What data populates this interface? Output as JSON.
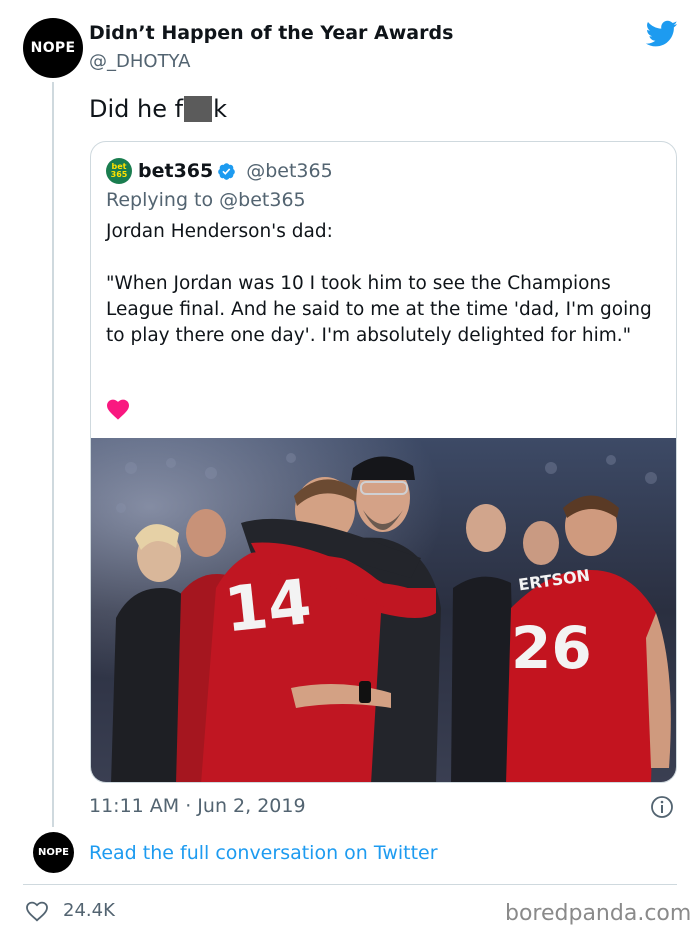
{
  "tweet": {
    "author_avatar_text": "NOPE",
    "author_name": "Didn’t Happen of the Year Awards",
    "author_handle": "@_DHOTYA",
    "text_start": "Did he f",
    "text_end": "k",
    "timestamp": "11:11 AM · Jun 2, 2019",
    "read_conversation_label": "Read the full conversation on Twitter",
    "like_count": "24.4K"
  },
  "quoted": {
    "logo_top": "bet",
    "logo_bottom": "365",
    "name": "bet365",
    "handle": "@bet365",
    "replying_prefix": "Replying to",
    "replying_handle": "@bet365",
    "paragraph1": "Jordan Henderson's dad:",
    "paragraph2": "\"When Jordan was 10 I took him to see the Champions League final. And he said to me at the time 'dad, I'm going to play there one day'. I'm absolutely delighted for him.\"",
    "photo": {
      "shirt_number_left": "14",
      "shirt_number_right": "26",
      "shirt_name_right": "ERTSON"
    }
  },
  "watermark": "boredpanda.com",
  "colors": {
    "accent": "#1d9bf0",
    "heart": "#f91880",
    "secondary_text": "#536471",
    "border": "#cfd9de"
  },
  "icons": [
    "twitter-bird-icon",
    "verified-badge-icon",
    "heart-icon",
    "info-icon",
    "like-outline-icon"
  ]
}
